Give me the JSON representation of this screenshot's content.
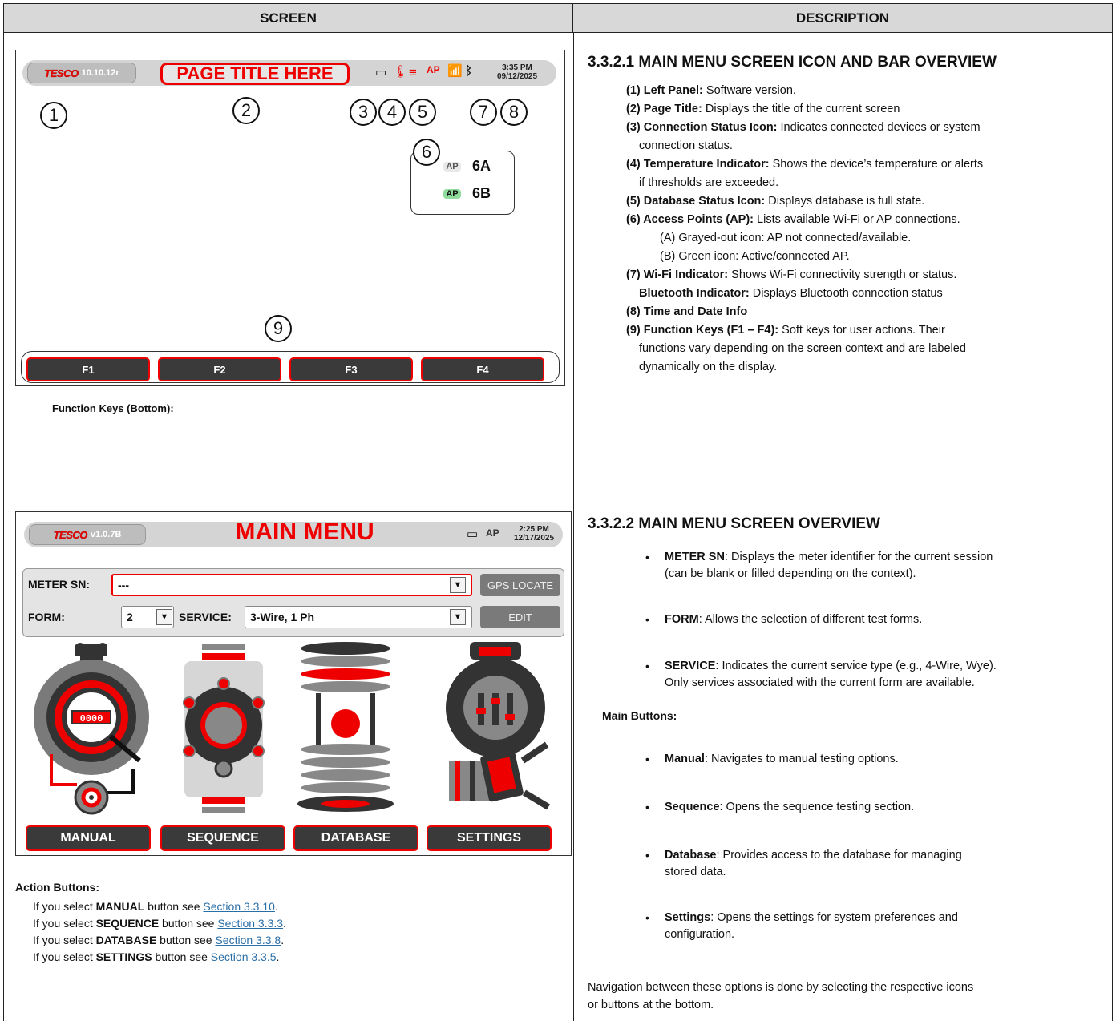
{
  "headers": {
    "screen": "SCREEN",
    "description": "DESCRIPTION"
  },
  "screen1": {
    "version": "10.10.12r",
    "logo": "TESCO",
    "page_title": "PAGE TITLE HERE",
    "time": "3:35 PM",
    "date": "09/12/2025",
    "numbers": [
      "1",
      "2",
      "3",
      "4",
      "5",
      "6",
      "7",
      "8",
      "9"
    ],
    "ap_6a": "6A",
    "ap_6b": "6B",
    "ap_icon": "AP",
    "fkeys": [
      "F1",
      "F2",
      "F3",
      "F4"
    ],
    "note": "Function Keys (Bottom):"
  },
  "desc1": {
    "title": "3.3.2.1 MAIN MENU SCREEN ICON AND BAR OVERVIEW",
    "items": [
      {
        "k": "(1) Left Panel:",
        "v": " Software version."
      },
      {
        "k": "(2) Page Title:",
        "v": " Displays the title of the current screen"
      },
      {
        "k": "(3) Connection Status Icon:",
        "v": " Indicates connected devices or system"
      },
      {
        "k": "",
        "v": "connection status."
      },
      {
        "k": "(4) Temperature Indicator:",
        "v": " Shows the device’s temperature or alerts"
      },
      {
        "k": "",
        "v": "if thresholds are exceeded."
      },
      {
        "k": "(5) Database Status Icon:",
        "v": " Displays database is full state."
      },
      {
        "k": "(6) Access Points (AP):",
        "v": " Lists available Wi-Fi or AP connections."
      },
      {
        "k": "",
        "v": "(A) Grayed-out icon: AP not connected/available."
      },
      {
        "k": "",
        "v": "(B) Green icon: Active/connected AP."
      },
      {
        "k": "(7) Wi-Fi Indicator:",
        "v": " Shows Wi-Fi connectivity strength or status."
      },
      {
        "k": "Bluetooth Indicator:",
        "v": " Displays Bluetooth connection status"
      },
      {
        "k": "(8) Time and Date Info",
        "v": ""
      },
      {
        "k": "(9) Function Keys (F1 – F4):",
        "v": " Soft keys for user actions. Their"
      },
      {
        "k": "",
        "v": "functions vary depending on the screen context and are labeled"
      },
      {
        "k": "",
        "v": "dynamically on the display."
      }
    ]
  },
  "screen2": {
    "version": "v1.0.7B",
    "logo": "TESCO",
    "title": "MAIN MENU",
    "time": "2:25 PM",
    "date": "12/17/2025",
    "ap_icon": "AP",
    "meter_label": "METER SN:",
    "meter_value": "---",
    "form_label": "FORM:",
    "form_value": "2",
    "service_label": "SERVICE:",
    "service_value": "3-Wire, 1 Ph",
    "gps_button": "GPS LOCATE",
    "edit_button": "EDIT",
    "meter_digits": "0000",
    "buttons": [
      "MANUAL",
      "SEQUENCE",
      "DATABASE",
      "SETTINGS"
    ]
  },
  "actions": {
    "heading": "Action Buttons:",
    "rows": [
      {
        "pre": "If you select ",
        "b": "MANUAL",
        "mid": " button see ",
        "link": "Section 3.3.10",
        "post": "."
      },
      {
        "pre": "If you select ",
        "b": "SEQUENCE",
        "mid": " button see ",
        "link": "Section 3.3.3",
        "post": "."
      },
      {
        "pre": "If you select ",
        "b": "DATABASE",
        "mid": " button see ",
        "link": "Section 3.3.8",
        "post": "."
      },
      {
        "pre": "If you select ",
        "b": "SETTINGS",
        "mid": " button see ",
        "link": "Section 3.3.5",
        "post": "."
      }
    ]
  },
  "desc2": {
    "title": "3.3.2.2 MAIN MENU SCREEN OVERVIEW",
    "b1k": "METER SN",
    "b1v": ": Displays the meter identifier for the current session",
    "b1v2": "(can be blank or filled depending on the context).",
    "b2k": "FORM",
    "b2v": ": Allows the selection of different test forms.",
    "b3k": "SERVICE",
    "b3v": ": Indicates the current service type (e.g., 4-Wire, Wye).",
    "b3v2": "Only services associated with the current form are available.",
    "main_buttons": "Main Buttons:",
    "b4k": "Manual",
    "b4v": ": Navigates to manual testing options.",
    "b5k": "Sequence",
    "b5v": ": Opens the sequence testing section.",
    "b6k": "Database",
    "b6v": ": Provides access to the database for managing",
    "b6v2": "stored data.",
    "b7k": "Settings",
    "b7v": ": Opens the settings for system preferences and",
    "b7v2": "configuration.",
    "nav1": "Navigation between these options is done by selecting the respective icons",
    "nav2": "or buttons at the bottom.",
    "bullet": "•"
  },
  "colors": {
    "accent_red": "#e00000",
    "button_dark": "#3a3a3a",
    "bar_gray": "#d4d4d4",
    "ap_green": "#2db34a"
  }
}
